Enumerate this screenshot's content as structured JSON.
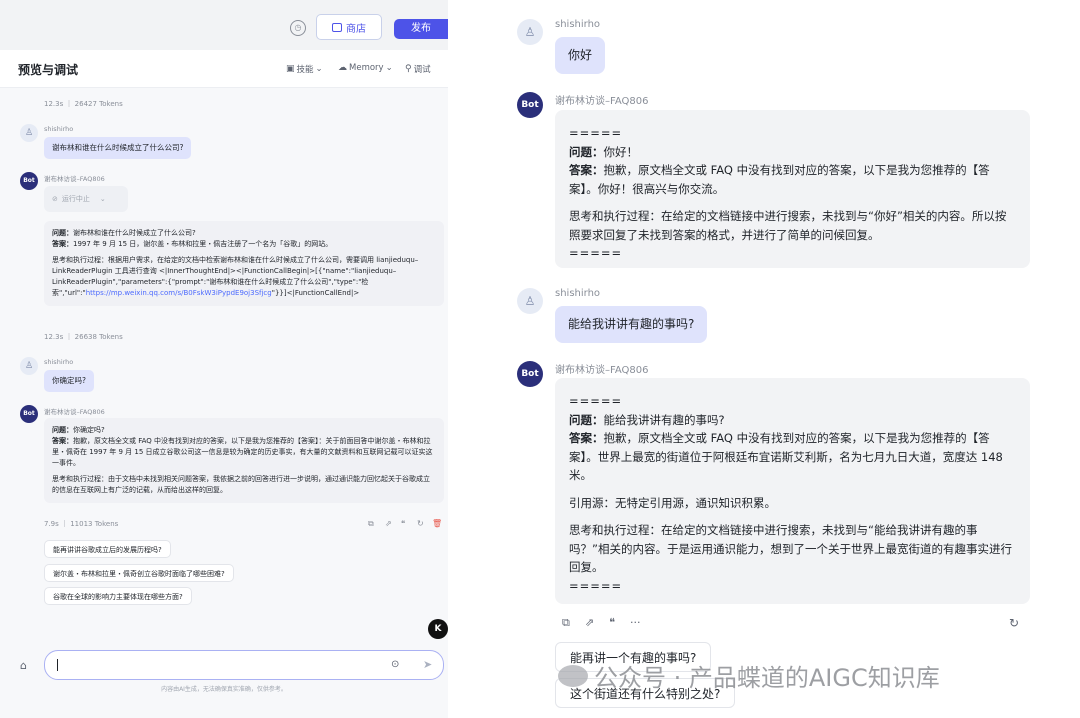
{
  "left": {
    "topbar": {
      "store_label": "商店",
      "publish_label": "发布"
    },
    "title": "预览与调试",
    "tools": {
      "skill": "技能",
      "memory": "Memory",
      "debug": "调试"
    },
    "stat1": "12.3s ｜ 26427 Tokens",
    "msg1": {
      "user": "shishirho",
      "text": "谢布林和谁在什么时候成立了什么公司?"
    },
    "bot1": {
      "name": "谢布林访谈–FAQ806",
      "interrupt": "运行中止"
    },
    "card1": {
      "q_label": "问题：",
      "q": "谢布林和谁在什么时候成立了什么公司?",
      "a_label": "答案：",
      "a": "1997 年 9 月 15 日，谢尔盖・布林和拉里・佩吉注册了一个名为「谷歌」的网站。",
      "think": "思考和执行过程：根据用户需求，在给定的文档中检索谢布林和谁在什么时候成立了什么公司，需要调用 lianjieduqu–LinkReaderPlugin 工具进行查询 <|InnerThoughtEnd|><|FunctionCallBegin|>[{\"name\":\"lianjieduqu–LinkReaderPlugin\",\"parameters\":{\"prompt\":\"谢布林和谁在什么时候成立了什么公司\",\"type\":\"检索\",\"url\":\"",
      "url": "https://mp.weixin.qq.com/s/B0FskW3iPypdE9oj3Sfjcg",
      "tail": "\"}}]<|FunctionCallEnd|>"
    },
    "stat2": "12.3s ｜ 26638 Tokens",
    "msg2": {
      "user": "shishirho",
      "text": "你确定吗?"
    },
    "bot2": {
      "name": "谢布林访谈–FAQ806"
    },
    "card2": {
      "q_label": "问题：",
      "q": "你确定吗?",
      "a_label": "答案：",
      "a": "抱歉，原文档全文或 FAQ 中没有找到对应的答案，以下是我为您推荐的【答案】：关于前面回答中谢尔盖・布林和拉里・佩奇在 1997 年 9 月 15 日成立谷歌公司这一信息是较为确定的历史事实，有大量的文献资料和互联网记载可以证实这一事件。",
      "think": "思考和执行过程：由于文档中未找到相关问题答案，我依据之前的回答进行进一步说明，通过通识能力回忆起关于谷歌成立的信息在互联网上有广泛的记载，从而给出这样的回复。"
    },
    "stat3": "7.9s ｜ 11013 Tokens",
    "suggestions": [
      "能再讲讲谷歌成立后的发展历程吗?",
      "谢尔盖・布林和拉里・佩奇创立谷歌时面临了哪些困难?",
      "谷歌在全球的影响力主要体现在哪些方面?"
    ],
    "badge": "K",
    "disclaimer": "内容由AI生成，无法确保真实准确，仅供参考。"
  },
  "right": {
    "msg1": {
      "user": "shishirho",
      "text": "你好"
    },
    "bot1": {
      "name": "谢布林访谈–FAQ806",
      "sep": "=====",
      "q_label": "问题：",
      "q": "你好！",
      "a_label": "答案：",
      "a": "抱歉，原文档全文或 FAQ 中没有找到对应的答案，以下是我为您推荐的【答案】。你好！很高兴与你交流。",
      "think": "思考和执行过程：在给定的文档链接中进行搜索，未找到与“你好”相关的内容。所以按照要求回复了未找到答案的格式，并进行了简单的问候回复。",
      "sep2": "====="
    },
    "msg2": {
      "user": "shishirho",
      "text": "能给我讲讲有趣的事吗?"
    },
    "bot2": {
      "name": "谢布林访谈–FAQ806",
      "sep": "=====",
      "q_label": "问题：",
      "q": "能给我讲讲有趣的事吗?",
      "a_label": "答案：",
      "a": "抱歉，原文档全文或 FAQ 中没有找到对应的答案，以下是我为您推荐的【答案】。世界上最宽的街道位于阿根廷布宜诺斯艾利斯，名为七月九日大道，宽度达 148 米。",
      "source": "引用源：无特定引用源，通识知识积累。",
      "think": "思考和执行过程：在给定的文档链接中进行搜索，未找到与“能给我讲讲有趣的事吗？”相关的内容。于是运用通识能力，想到了一个关于世界上最宽街道的有趣事实进行回复。",
      "sep2": "====="
    },
    "suggestions": [
      "能再讲一个有趣的事吗?",
      "这个街道还有什么特别之处?"
    ],
    "watermark": "公众号 · 产品蝶道的AIGC知识库"
  },
  "avatar_bot_label": "Bot"
}
